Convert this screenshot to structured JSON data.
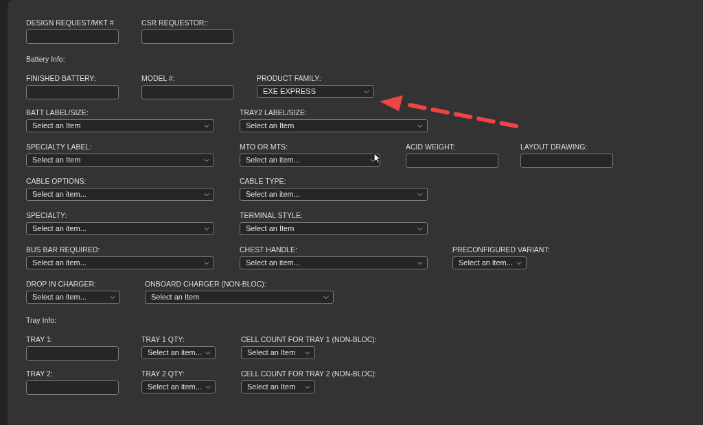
{
  "sections": [
    {
      "rows": [
        {
          "fields": [
            {
              "label": "DESIGN REQUEST/MKT #",
              "kind": "text"
            },
            {
              "label": "CSR REQUESTOR::",
              "kind": "text"
            }
          ]
        }
      ]
    },
    {
      "heading": "Battery Info:",
      "rows": [
        {
          "fields": [
            {
              "label": "FINISHED BATTERY:",
              "kind": "text"
            },
            {
              "label": "MODEL #:",
              "kind": "text"
            },
            {
              "label": "PRODUCT FAMILY:",
              "kind": "select",
              "value": "EXE EXPRESS"
            }
          ]
        },
        {
          "fields": [
            {
              "label": "BATT LABEL/SIZE:",
              "kind": "select",
              "value": "Select an Item"
            },
            {
              "label": "TRAY2 LABEL/SIZE:",
              "kind": "select",
              "value": "Select an Item"
            }
          ]
        },
        {
          "fields": [
            {
              "label": "SPECIALTY LABEL:",
              "kind": "select",
              "value": "Select an Item"
            },
            {
              "label": "MTO OR MTS:",
              "kind": "select",
              "value": "Select an item..."
            },
            {
              "label": "ACID WEIGHT:",
              "kind": "text"
            },
            {
              "label": "LAYOUT DRAWING:",
              "kind": "text"
            }
          ]
        },
        {
          "fields": [
            {
              "label": "CABLE OPTIONS:",
              "kind": "select",
              "value": "Select an item..."
            },
            {
              "label": "CABLE TYPE:",
              "kind": "select",
              "value": "Select an item..."
            }
          ]
        },
        {
          "fields": [
            {
              "label": "SPECIALTY:",
              "kind": "select",
              "value": "Select an item..."
            },
            {
              "label": "TERMINAL STYLE:",
              "kind": "select",
              "value": "Select an Item"
            }
          ]
        },
        {
          "fields": [
            {
              "label": "BUS BAR REQUIRED:",
              "kind": "select",
              "value": "Select an item..."
            },
            {
              "label": "CHEST HANDLE:",
              "kind": "select",
              "value": "Select an item..."
            },
            {
              "label": "PRECONFIGURED VARIANT:",
              "kind": "select",
              "value": "Select an item..."
            }
          ]
        },
        {
          "fields": [
            {
              "label": "DROP IN CHARGER:",
              "kind": "select",
              "value": "Select an item..."
            },
            {
              "label": "ONBOARD CHARGER (NON-BLOC):",
              "kind": "select",
              "value": "Select an Item"
            }
          ]
        }
      ]
    },
    {
      "heading": "Tray Info:",
      "rows": [
        {
          "fields": [
            {
              "label": "TRAY 1:",
              "kind": "text"
            },
            {
              "label": "TRAY 1 QTY:",
              "kind": "select",
              "value": "Select an item..."
            },
            {
              "label": "CELL COUNT FOR TRAY 1 (NON-BLOC):",
              "kind": "select",
              "value": "Select an Item"
            }
          ]
        },
        {
          "fields": [
            {
              "label": "TRAY 2:",
              "kind": "text"
            },
            {
              "label": "TRAY 2 QTY:",
              "kind": "select",
              "value": "Select an item..."
            },
            {
              "label": "CELL COUNT FOR TRAY 2 (NON-BLOC):",
              "kind": "select",
              "value": "Select an Item"
            }
          ]
        }
      ]
    }
  ]
}
